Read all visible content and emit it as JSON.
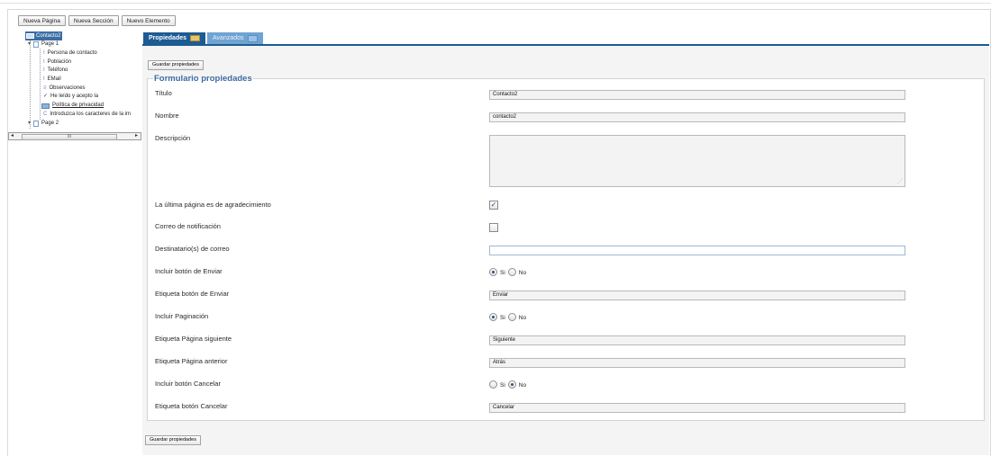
{
  "toolbar": {
    "new_page": "Nueva Página",
    "new_section": "Nueva Sección",
    "new_element": "Nuevo Elemento"
  },
  "tree": {
    "root": "Contacto2",
    "page1": "Page 1",
    "items": [
      "Persona de contacto",
      "Población",
      "Teléfono",
      "EMail",
      "Observaciones",
      "He leído y acepto la",
      "Política de privacidad",
      "Introduzca los caracteres de la im"
    ],
    "page2": "Page 2",
    "scroll_grip": "III"
  },
  "tabs": {
    "properties": "Propiedades",
    "advanced": "Avanzados"
  },
  "buttons": {
    "save_top": "Guardar propiedades",
    "save_bottom": "Guardar propiedades"
  },
  "form": {
    "legend": "Formulario propiedades",
    "title_label": "Título",
    "title_value": "Contacto2",
    "name_label": "Nombre",
    "name_value": "contacto2",
    "description_label": "Descripción",
    "description_value": "",
    "last_page_thanks_label": "La última página es de agradecimiento",
    "last_page_thanks_checked": true,
    "notify_email_label": "Correo de notificación",
    "notify_email_checked": false,
    "recipients_label": "Destinatario(s) de correo",
    "recipients_value": "",
    "include_send_label": "Incluir botón de Enviar",
    "include_send_yes": "Si",
    "include_send_no": "No",
    "include_send_value": "Si",
    "send_label_label": "Etiqueta botón de Enviar",
    "send_label_value": "Enviar",
    "include_pagination_label": "Incluir Paginación",
    "include_pagination_yes": "Si",
    "include_pagination_no": "No",
    "include_pagination_value": "Si",
    "next_label_label": "Etiqueta Página siguiente",
    "next_label_value": "Siguiente",
    "prev_label_label": "Etiqueta Página anterior",
    "prev_label_value": "Atrás",
    "include_cancel_label": "Incluir botón Cancelar",
    "include_cancel_yes": "Si",
    "include_cancel_no": "No",
    "include_cancel_value": "No",
    "cancel_label_label": "Etiqueta botón Cancelar",
    "cancel_label_value": "Cancelar"
  }
}
